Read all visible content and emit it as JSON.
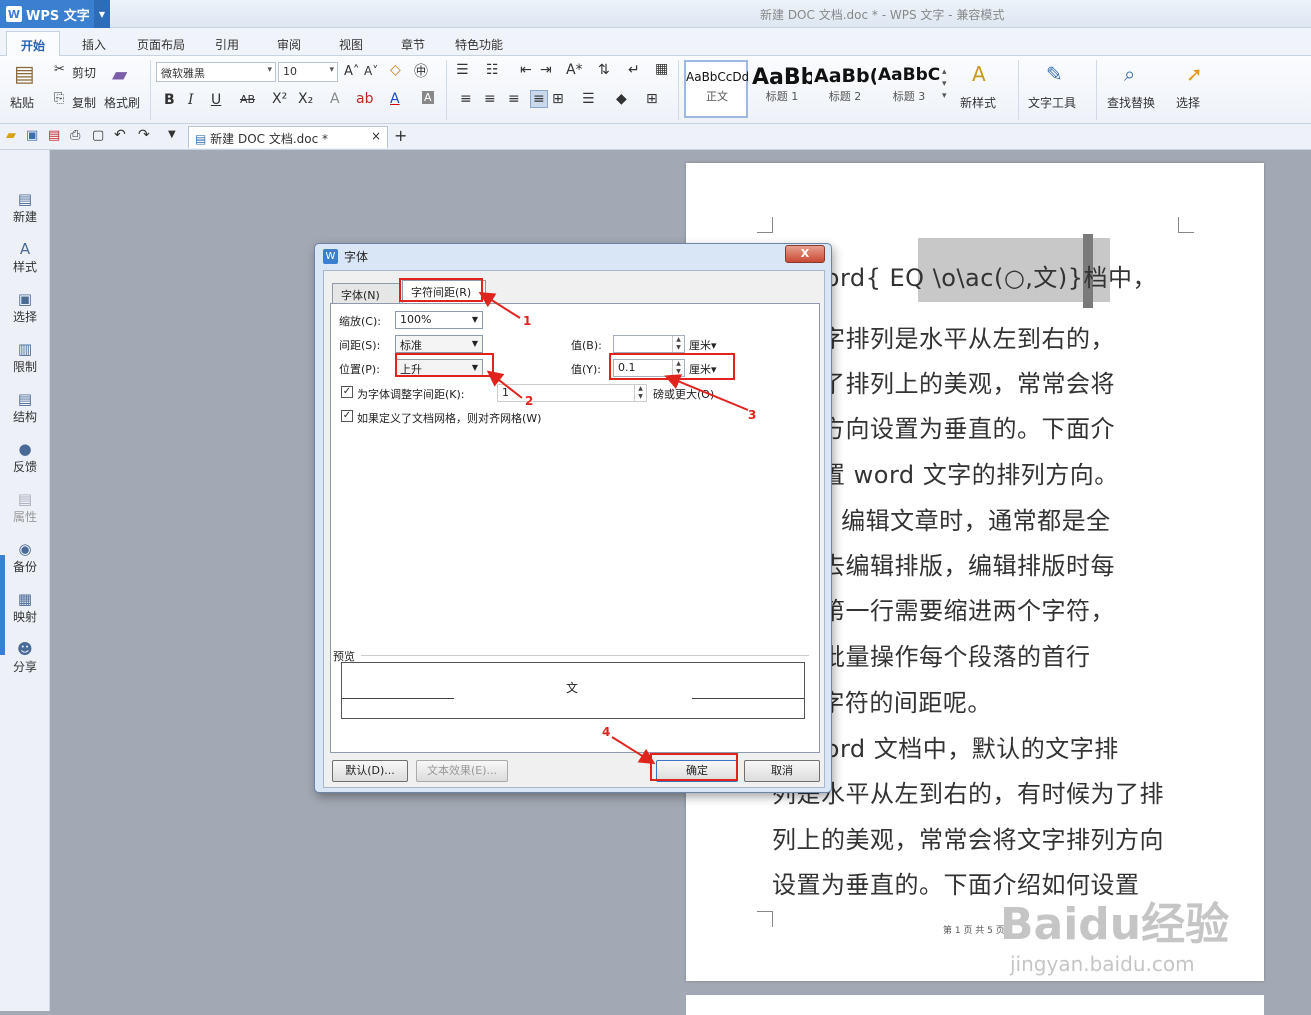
{
  "app": {
    "name": "WPS 文字",
    "window_title": "新建 DOC 文档.doc * - WPS 文字 - 兼容模式"
  },
  "menu": [
    "开始",
    "插入",
    "页面布局",
    "引用",
    "审阅",
    "视图",
    "章节",
    "特色功能"
  ],
  "ribbon": {
    "clipboard": {
      "paste": "粘贴",
      "cut": "剪切",
      "copy": "复制",
      "format_painter": "格式刷"
    },
    "font_name": "微软雅黑",
    "font_size": "10",
    "styles": [
      {
        "preview": "AaBbCcDd",
        "name": "正文"
      },
      {
        "preview": "AaBb",
        "name": "标题 1"
      },
      {
        "preview": "AaBb(",
        "name": "标题 2"
      },
      {
        "preview": "AaBbC",
        "name": "标题 3"
      }
    ],
    "new_style": "新样式",
    "text_tools": "文字工具",
    "find_replace": "查找替换",
    "select": "选择"
  },
  "doc_tab": "新建 DOC 文档.doc *",
  "sidebar": [
    "新建",
    "样式",
    "选择",
    "限制",
    "结构",
    "反馈",
    "属性",
    "备份",
    "映射",
    "分享"
  ],
  "document": {
    "lines": [
      "在 word{  EQ \\o\\ac(○,文)}档中，",
      "的文字排列是水平从左到右的，",
      "候为了排列上的美观，常常会将",
      "排列方向设置为垂直的。下面介",
      "何设置 word 文字的排列方向。",
      "word 编辑文章时，通常都是全",
      "完再去编辑排版，编辑排版时每",
      "落的第一行需要缩进两个字符，",
      "如何批量操作每个段落的首行",
      "2 个字符的间距呢。",
      "在 word 文档中，默认的文字排",
      "列是水平从左到右的，有时候为了排",
      "列上的美观，常常会将文字排列方向",
      "设置为垂直的。下面介绍如何设置"
    ],
    "footer": "第 1 页 共 5 页",
    "watermark": "Baidu经验",
    "watermark_url": "jingyan.baidu.com"
  },
  "dialog": {
    "title": "字体",
    "close": "X",
    "tabs": [
      "字体(N)",
      "字符间距(R)"
    ],
    "scale_label": "缩放(C):",
    "scale_value": "100%",
    "spacing_label": "间距(S):",
    "spacing_value": "标准",
    "position_label": "位置(P):",
    "position_value": "上升",
    "by_label_b": "值(B):",
    "by_value_b": "",
    "unit_b": "厘米▾",
    "by_label_y": "值(Y):",
    "by_value_y": "0.1",
    "unit_y": "厘米▾",
    "kerning_label": "为字体调整字间距(K):",
    "kerning_value": "1",
    "kerning_suffix": "磅或更大(O)",
    "grid_label": "如果定义了文档网格，则对齐网格(W)",
    "preview_label": "预览",
    "preview_text": "文",
    "btn_default": "默认(D)...",
    "btn_effects": "文本效果(E)...",
    "btn_ok": "确定",
    "btn_cancel": "取消"
  },
  "annotations": [
    "1",
    "2",
    "3",
    "4"
  ],
  "colors": {
    "accent": "#3b7fd0",
    "highlight": "#e0241d"
  }
}
